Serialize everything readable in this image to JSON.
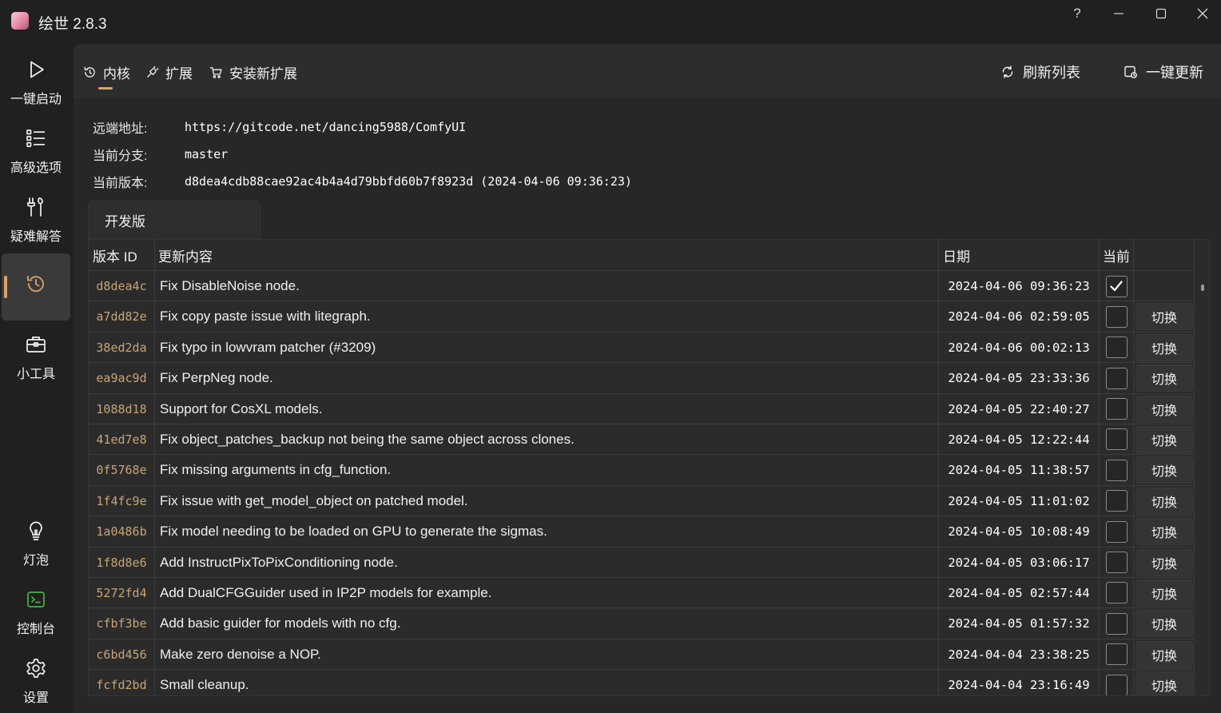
{
  "window": {
    "title": "绘世 2.8.3",
    "help_label": "?"
  },
  "sidebar": {
    "items": [
      {
        "label": "一键启动",
        "icon": "play-icon"
      },
      {
        "label": "高级选项",
        "icon": "list-icon"
      },
      {
        "label": "疑难解答",
        "icon": "tools-icon"
      },
      {
        "label": "",
        "icon": "history-icon",
        "active": true
      },
      {
        "label": "小工具",
        "icon": "toolbox-icon"
      },
      {
        "label": "灯泡",
        "icon": "lightbulb-icon"
      },
      {
        "label": "控制台",
        "icon": "console-icon"
      },
      {
        "label": "设置",
        "icon": "gear-icon"
      }
    ]
  },
  "tabs": [
    {
      "label": "内核",
      "icon": "history-icon",
      "active": true
    },
    {
      "label": "扩展",
      "icon": "plug-icon"
    },
    {
      "label": "安装新扩展",
      "icon": "cart-icon"
    }
  ],
  "toolbar": {
    "refresh_label": "刷新列表",
    "update_label": "一键更新"
  },
  "info": {
    "remote_key": "远端地址:",
    "remote_val": "https://gitcode.net/dancing5988/ComfyUI",
    "branch_key": "当前分支:",
    "branch_val": "master",
    "version_key": "当前版本:",
    "version_val": "d8dea4cdb88cae92ac4b4a4d79bbfd60b7f8923d (2024-04-06 09:36:23)"
  },
  "branch_tab": "开发版",
  "table": {
    "headers": {
      "id": "版本 ID",
      "message": "更新内容",
      "date": "日期",
      "current": "当前"
    },
    "switch_label": "切换",
    "rows": [
      {
        "id": "d8dea4c",
        "message": "Fix DisableNoise node.",
        "date": "2024-04-06 09:36:23",
        "current": true
      },
      {
        "id": "a7dd82e",
        "message": "Fix copy paste issue with litegraph.",
        "date": "2024-04-06 02:59:05",
        "current": false
      },
      {
        "id": "38ed2da",
        "message": "Fix typo in lowvram patcher (#3209)",
        "date": "2024-04-06 00:02:13",
        "current": false
      },
      {
        "id": "ea9ac9d",
        "message": "Fix PerpNeg node.",
        "date": "2024-04-05 23:33:36",
        "current": false
      },
      {
        "id": "1088d18",
        "message": "Support for CosXL models.",
        "date": "2024-04-05 22:40:27",
        "current": false
      },
      {
        "id": "41ed7e8",
        "message": "Fix object_patches_backup not being the same object across clones.",
        "date": "2024-04-05 12:22:44",
        "current": false
      },
      {
        "id": "0f5768e",
        "message": "Fix missing arguments in cfg_function.",
        "date": "2024-04-05 11:38:57",
        "current": false
      },
      {
        "id": "1f4fc9e",
        "message": "Fix issue with get_model_object on patched model.",
        "date": "2024-04-05 11:01:02",
        "current": false
      },
      {
        "id": "1a0486b",
        "message": "Fix model needing to be loaded on GPU to generate the sigmas.",
        "date": "2024-04-05 10:08:49",
        "current": false
      },
      {
        "id": "1f8d8e6",
        "message": "Add InstructPixToPixConditioning node.",
        "date": "2024-04-05 03:06:17",
        "current": false
      },
      {
        "id": "5272fd4",
        "message": "Add DualCFGGuider used in IP2P models for example.",
        "date": "2024-04-05 02:57:44",
        "current": false
      },
      {
        "id": "cfbf3be",
        "message": "Add basic guider for models with no cfg.",
        "date": "2024-04-05 01:57:32",
        "current": false
      },
      {
        "id": "c6bd456",
        "message": "Make zero denoise a NOP.",
        "date": "2024-04-04 23:38:25",
        "current": false
      },
      {
        "id": "fcfd2bd",
        "message": "Small cleanup.",
        "date": "2024-04-04 23:16:49",
        "current": false
      }
    ]
  },
  "colors": {
    "accent": "#d9a36a",
    "version_id": "#c8a474",
    "console_icon": "#4caf50"
  }
}
